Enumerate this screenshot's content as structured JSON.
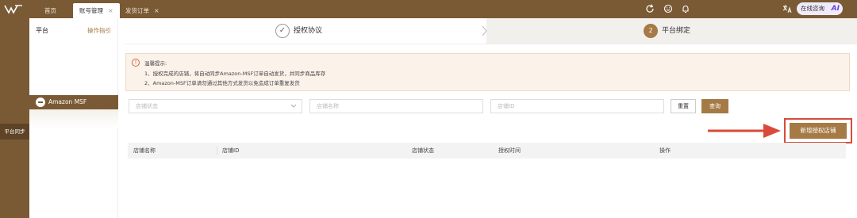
{
  "topbar": {
    "tabs": [
      {
        "label": "首页",
        "closable": false,
        "active": false
      },
      {
        "label": "账号管理",
        "closable": true,
        "active": true
      },
      {
        "label": "发货订单",
        "closable": true,
        "active": false
      }
    ],
    "close_glyph": "×",
    "icons": [
      "refresh-icon",
      "smile-icon",
      "bell-icon",
      "translate-icon"
    ],
    "ai_button": {
      "label": "在线咨询",
      "badge": "AI"
    }
  },
  "rail": {
    "items": [
      {
        "label": "平台同步",
        "active": true
      }
    ]
  },
  "platform_panel": {
    "title": "平台",
    "guide_link": "操作指引",
    "items": [
      {
        "label": "Amazon MSF",
        "active": true
      }
    ]
  },
  "steps": [
    {
      "label": "授权协议",
      "marker": "✓",
      "state": "done"
    },
    {
      "label": "平台绑定",
      "marker": "2",
      "state": "current"
    }
  ],
  "notice": {
    "title": "温馨提示:",
    "lines": [
      "1、授权完成的店铺，将自动同步Amazon-MSF订单自动发货，并同步商品库存",
      "2、Amazon-MSF订单请勿通过其他方式发货以免造成订单重复发货"
    ]
  },
  "filters": {
    "status_placeholder": "店铺状态",
    "name_placeholder": "店铺名称",
    "id_placeholder": "店铺ID",
    "reset_label": "重置",
    "search_label": "查询"
  },
  "actions": {
    "add_store_label": "新增授权店铺"
  },
  "table": {
    "columns": [
      "店铺名称",
      "店铺ID",
      "店铺状态",
      "授权时间",
      "操作"
    ]
  },
  "colors": {
    "brand": "#7a5a35",
    "accent": "#a57a45",
    "highlight_red": "#d94a3a"
  }
}
